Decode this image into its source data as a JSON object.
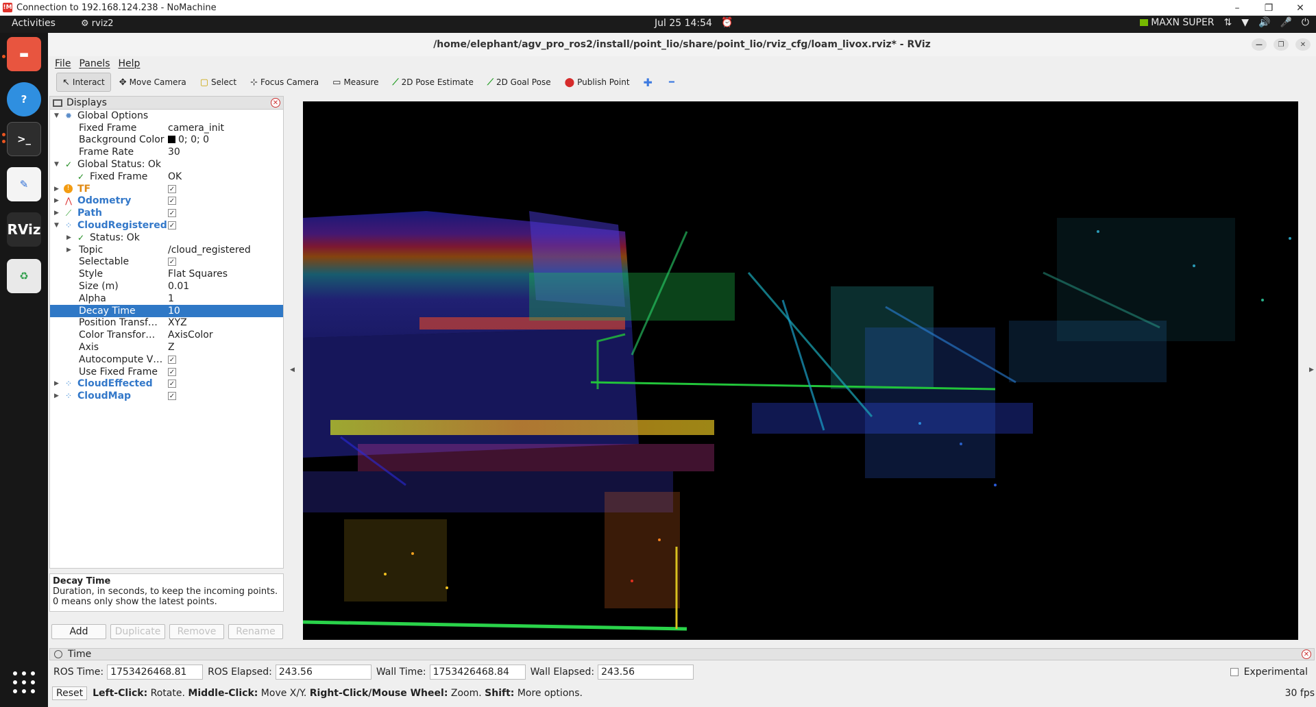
{
  "nomachine": {
    "title": "Connection to 192.168.124.238 - NoMachine",
    "logo": "!M",
    "controls": [
      "–",
      "❐",
      "✕"
    ]
  },
  "gnome": {
    "activities": "Activities",
    "app_name": "rviz2",
    "clock": "Jul 25  14:54",
    "power_mode": "MAXN SUPER"
  },
  "dock": {
    "items": [
      "files-icon",
      "help-icon",
      "terminal-icon",
      "text-editor-icon",
      "rviz-icon",
      "trash-icon"
    ],
    "rviz_label": "RViz"
  },
  "window": {
    "title": "/home/elephant/agv_pro_ros2/install/point_lio/share/point_lio/rviz_cfg/loam_livox.rviz* - RViz"
  },
  "menu": [
    "File",
    "Panels",
    "Help"
  ],
  "toolbar": {
    "interact": "Interact",
    "move_camera": "Move Camera",
    "select": "Select",
    "focus_camera": "Focus Camera",
    "measure": "Measure",
    "pose_estimate": "2D Pose Estimate",
    "goal_pose": "2D Goal Pose",
    "publish_point": "Publish Point"
  },
  "displays": {
    "title": "Displays",
    "global_options": "Global Options",
    "fixed_frame": {
      "label": "Fixed Frame",
      "value": "camera_init"
    },
    "background_color": {
      "label": "Background Color",
      "value": "0; 0; 0",
      "color": "#000000"
    },
    "frame_rate": {
      "label": "Frame Rate",
      "value": "30"
    },
    "global_status": "Global Status: Ok",
    "status_fixed_frame": {
      "label": "Fixed Frame",
      "value": "OK"
    },
    "tf": "TF",
    "odometry": "Odometry",
    "path": "Path",
    "cloud_registered": "CloudRegistered",
    "cr_status": "Status: Ok",
    "topic": {
      "label": "Topic",
      "value": "/cloud_registered"
    },
    "selectable": {
      "label": "Selectable"
    },
    "style": {
      "label": "Style",
      "value": "Flat Squares"
    },
    "size": {
      "label": "Size (m)",
      "value": "0.01"
    },
    "alpha": {
      "label": "Alpha",
      "value": "1"
    },
    "decay_time": {
      "label": "Decay Time",
      "value": "10"
    },
    "position_transformer": {
      "label": "Position Transf…",
      "value": "XYZ"
    },
    "color_transformer": {
      "label": "Color Transfor…",
      "value": "AxisColor"
    },
    "axis": {
      "label": "Axis",
      "value": "Z"
    },
    "autocompute": {
      "label": "Autocompute V…"
    },
    "use_fixed_frame": {
      "label": "Use Fixed Frame"
    },
    "cloud_effected": "CloudEffected",
    "cloud_map": "CloudMap"
  },
  "description": {
    "title": "Decay Time",
    "text": "Duration, in seconds, to keep the incoming points. 0 means only show the latest points."
  },
  "panel_buttons": {
    "add": "Add",
    "duplicate": "Duplicate",
    "remove": "Remove",
    "rename": "Rename"
  },
  "time": {
    "title": "Time",
    "ros_time_label": "ROS Time:",
    "ros_time": "1753426468.81",
    "ros_elapsed_label": "ROS Elapsed:",
    "ros_elapsed": "243.56",
    "wall_time_label": "Wall Time:",
    "wall_time": "1753426468.84",
    "wall_elapsed_label": "Wall Elapsed:",
    "wall_elapsed": "243.56",
    "experimental": "Experimental"
  },
  "status": {
    "reset": "Reset",
    "left_click": "Left-Click:",
    "left_click_action": " Rotate. ",
    "middle_click": "Middle-Click:",
    "middle_click_action": " Move X/Y. ",
    "right_click": "Right-Click/Mouse Wheel:",
    "right_click_action": " Zoom. ",
    "shift": "Shift:",
    "shift_action": " More options.",
    "fps": "30 fps"
  },
  "colors": {
    "selection": "#2f78c6",
    "display_name": "#3378c9",
    "viewport_bg": "#000000"
  }
}
